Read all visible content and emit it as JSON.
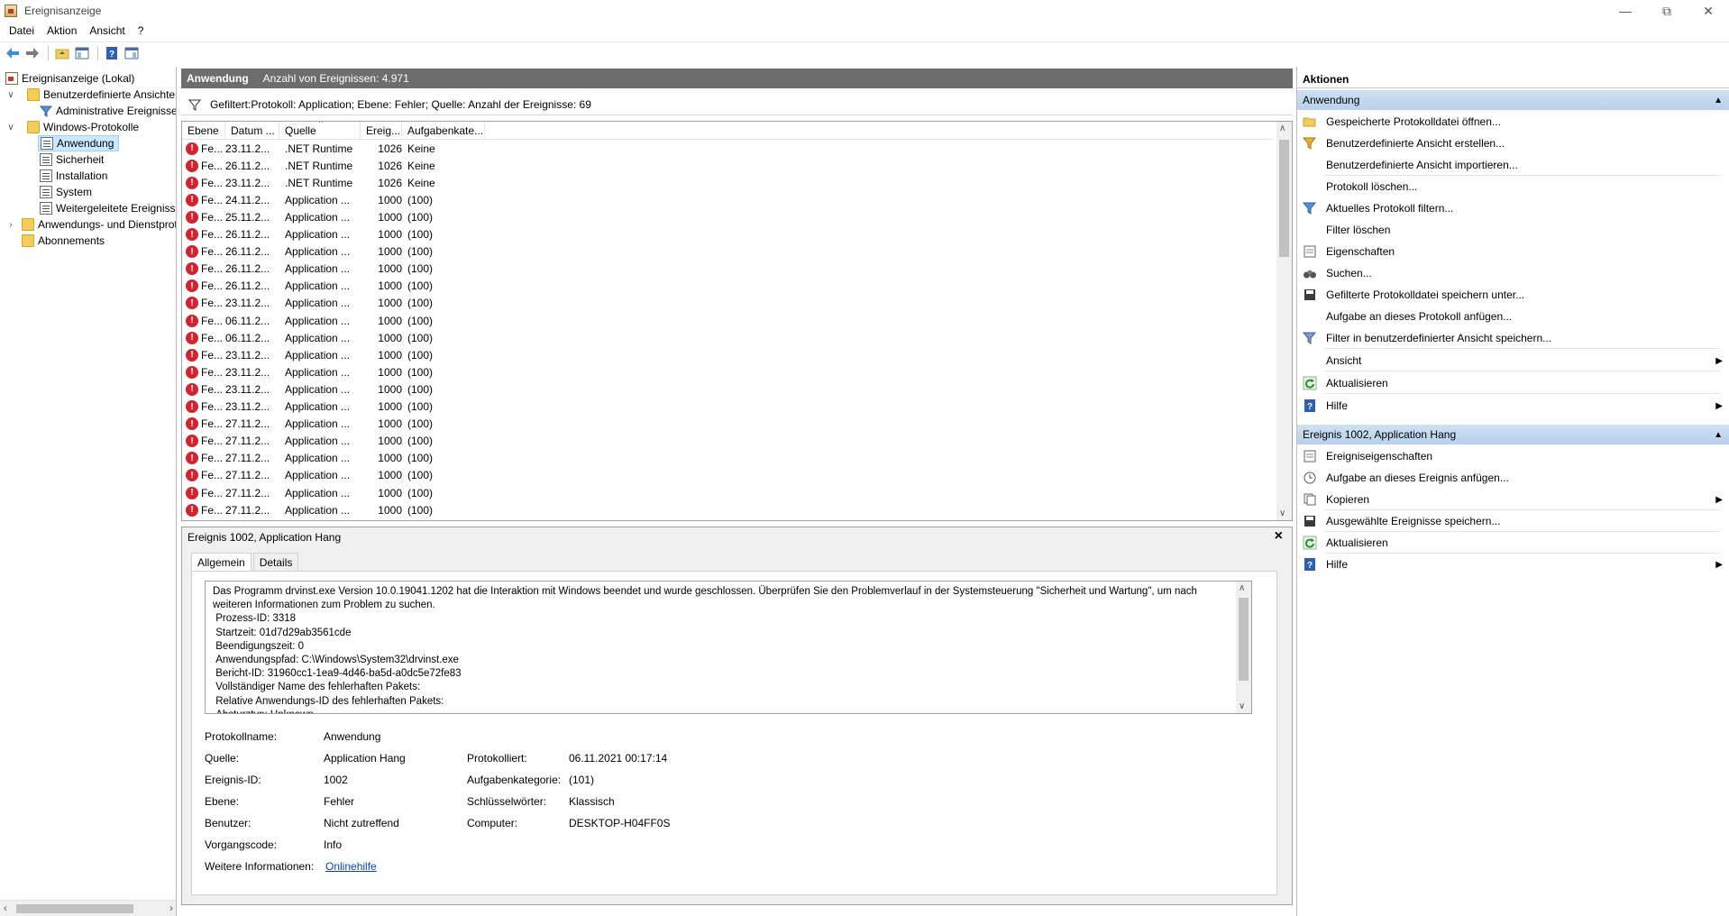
{
  "window": {
    "title": "Ereignisanzeige"
  },
  "menu": [
    "Datei",
    "Aktion",
    "Ansicht",
    "?"
  ],
  "tree": {
    "root": "Ereignisanzeige (Lokal)",
    "custom_views": "Benutzerdefinierte Ansichten",
    "admin_events": "Administrative Ereignisse",
    "windows_logs": "Windows-Protokolle",
    "application": "Anwendung",
    "security": "Sicherheit",
    "installation": "Installation",
    "system": "System",
    "forwarded": "Weitergeleitete Ereignisse",
    "app_services": "Anwendungs- und Dienstprotokolle",
    "subscriptions": "Abonnements"
  },
  "list": {
    "header_title": "Anwendung",
    "header_count": "Anzahl von Ereignissen: 4.971",
    "filter_text": "Gefiltert:Protokoll: Application; Ebene: Fehler; Quelle:  Anzahl der Ereignisse: 69",
    "columns": [
      "Ebene",
      "Datum ...",
      "Quelle",
      "Ereig...",
      "Aufgabenkate..."
    ],
    "rows": [
      [
        "Fe...",
        "23.11.2...",
        ".NET Runtime",
        "1026",
        "Keine"
      ],
      [
        "Fe...",
        "26.11.2...",
        ".NET Runtime",
        "1026",
        "Keine"
      ],
      [
        "Fe...",
        "23.11.2...",
        ".NET Runtime",
        "1026",
        "Keine"
      ],
      [
        "Fe...",
        "24.11.2...",
        "Application ...",
        "1000",
        "(100)"
      ],
      [
        "Fe...",
        "25.11.2...",
        "Application ...",
        "1000",
        "(100)"
      ],
      [
        "Fe...",
        "26.11.2...",
        "Application ...",
        "1000",
        "(100)"
      ],
      [
        "Fe...",
        "26.11.2...",
        "Application ...",
        "1000",
        "(100)"
      ],
      [
        "Fe...",
        "26.11.2...",
        "Application ...",
        "1000",
        "(100)"
      ],
      [
        "Fe...",
        "26.11.2...",
        "Application ...",
        "1000",
        "(100)"
      ],
      [
        "Fe...",
        "23.11.2...",
        "Application ...",
        "1000",
        "(100)"
      ],
      [
        "Fe...",
        "06.11.2...",
        "Application ...",
        "1000",
        "(100)"
      ],
      [
        "Fe...",
        "06.11.2...",
        "Application ...",
        "1000",
        "(100)"
      ],
      [
        "Fe...",
        "23.11.2...",
        "Application ...",
        "1000",
        "(100)"
      ],
      [
        "Fe...",
        "23.11.2...",
        "Application ...",
        "1000",
        "(100)"
      ],
      [
        "Fe...",
        "23.11.2...",
        "Application ...",
        "1000",
        "(100)"
      ],
      [
        "Fe...",
        "23.11.2...",
        "Application ...",
        "1000",
        "(100)"
      ],
      [
        "Fe...",
        "27.11.2...",
        "Application ...",
        "1000",
        "(100)"
      ],
      [
        "Fe...",
        "27.11.2...",
        "Application ...",
        "1000",
        "(100)"
      ],
      [
        "Fe...",
        "27.11.2...",
        "Application ...",
        "1000",
        "(100)"
      ],
      [
        "Fe...",
        "27.11.2...",
        "Application ...",
        "1000",
        "(100)"
      ],
      [
        "Fe...",
        "27.11.2...",
        "Application ...",
        "1000",
        "(100)"
      ],
      [
        "Fe...",
        "27.11.2...",
        "Application ...",
        "1000",
        "(100)"
      ]
    ]
  },
  "detail": {
    "title": "Ereignis 1002, Application Hang",
    "tabs": [
      "Allgemein",
      "Details"
    ],
    "description": "Das Programm drvinst.exe Version 10.0.19041.1202 hat die Interaktion mit Windows beendet und wurde geschlossen. Überprüfen Sie den Problemverlauf in der Systemsteuerung \"Sicherheit und Wartung\", um nach weiteren Informationen zum Problem zu suchen.\n Prozess-ID: 3318\n Startzeit: 01d7d29ab3561cde\n Beendigungszeit: 0\n Anwendungspfad: C:\\Windows\\System32\\drvinst.exe\n Bericht-ID: 31960cc1-1ea9-4d46-ba5d-a0dc5e72fe83\n Vollständiger Name des fehlerhaften Pakets:\n Relative Anwendungs-ID des fehlerhaften Pakets:\n Absturztyp: Unknown",
    "props": {
      "log_name_label": "Protokollname:",
      "log_name": "Anwendung",
      "source_label": "Quelle:",
      "source": "Application Hang",
      "logged_label": "Protokolliert:",
      "logged": "06.11.2021 00:17:14",
      "event_id_label": "Ereignis-ID:",
      "event_id": "1002",
      "task_label": "Aufgabenkategorie:",
      "task": "(101)",
      "level_label": "Ebene:",
      "level": "Fehler",
      "keywords_label": "Schlüsselwörter:",
      "keywords": "Klassisch",
      "user_label": "Benutzer:",
      "user": "Nicht zutreffend",
      "computer_label": "Computer:",
      "computer": "DESKTOP-H04FF0S",
      "opcode_label": "Vorgangscode:",
      "opcode": "Info",
      "more_info_label": "Weitere Informationen:",
      "more_info_link": "Onlinehilfe"
    }
  },
  "actions": {
    "title": "Aktionen",
    "section1": "Anwendung",
    "items1": [
      {
        "label": "Gespeicherte Protokolldatei öffnen...",
        "icon": "open-folder-icon"
      },
      {
        "label": "Benutzerdefinierte Ansicht erstellen...",
        "icon": "filter-star-icon"
      },
      {
        "label": "Benutzerdefinierte Ansicht importieren...",
        "icon": ""
      },
      {
        "label": "Protokoll löschen...",
        "icon": ""
      },
      {
        "label": "Aktuelles Protokoll filtern...",
        "icon": "filter-icon"
      },
      {
        "label": "Filter löschen",
        "icon": ""
      },
      {
        "label": "Eigenschaften",
        "icon": "properties-icon"
      },
      {
        "label": "Suchen...",
        "icon": "binoculars-icon"
      },
      {
        "label": "Gefilterte Protokolldatei speichern unter...",
        "icon": "save-icon"
      },
      {
        "label": "Aufgabe an dieses Protokoll anfügen...",
        "icon": ""
      },
      {
        "label": "Filter in benutzerdefinierter Ansicht speichern...",
        "icon": "filter-save-icon"
      },
      {
        "label": "Ansicht",
        "icon": "",
        "submenu": true
      },
      {
        "label": "Aktualisieren",
        "icon": "refresh-icon"
      },
      {
        "label": "Hilfe",
        "icon": "help-icon",
        "submenu": true
      }
    ],
    "section2": "Ereignis 1002, Application Hang",
    "items2": [
      {
        "label": "Ereigniseigenschaften",
        "icon": "properties-icon"
      },
      {
        "label": "Aufgabe an dieses Ereignis anfügen...",
        "icon": "task-icon"
      },
      {
        "label": "Kopieren",
        "icon": "copy-icon",
        "submenu": true
      },
      {
        "label": "Ausgewählte Ereignisse speichern...",
        "icon": "save-icon"
      },
      {
        "label": "Aktualisieren",
        "icon": "refresh-icon"
      },
      {
        "label": "Hilfe",
        "icon": "help-icon",
        "submenu": true
      }
    ]
  }
}
